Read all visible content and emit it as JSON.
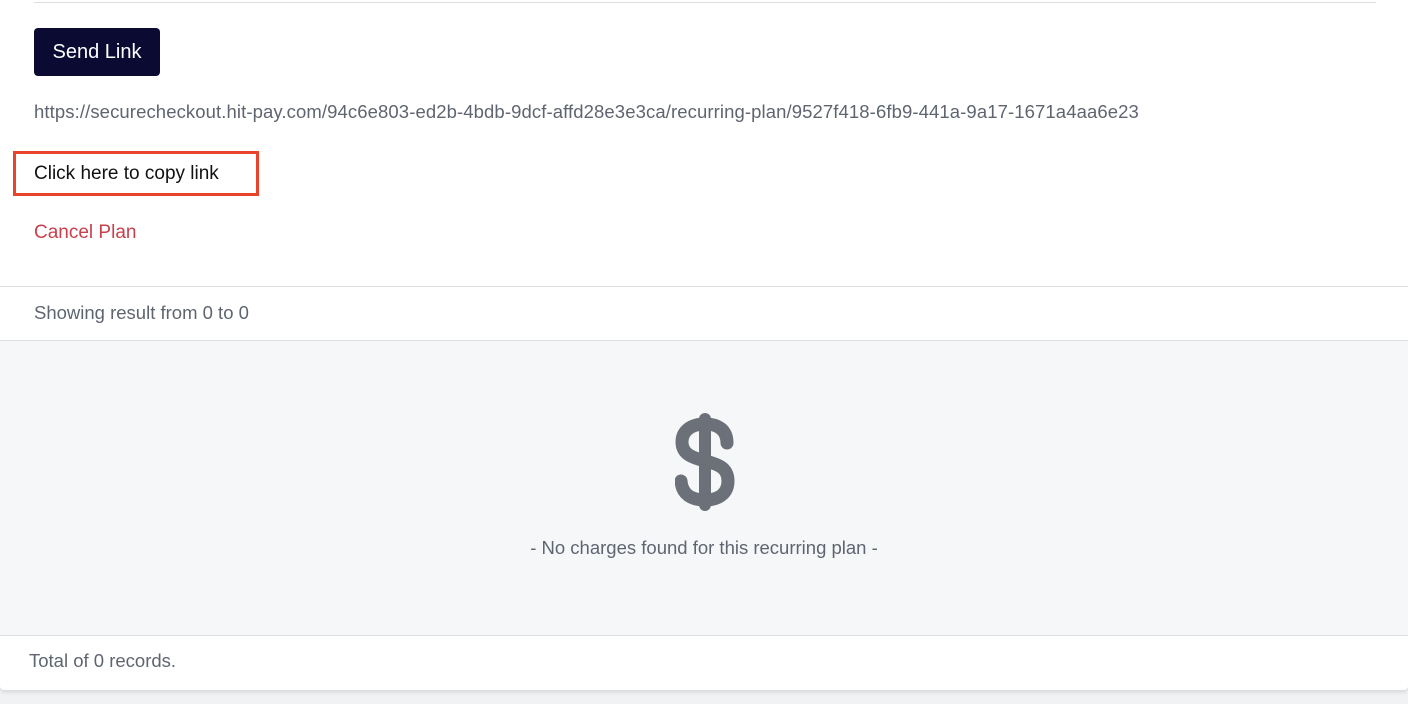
{
  "actions": {
    "send_link_label": "Send Link",
    "checkout_url": "https://securecheckout.hit-pay.com/94c6e803-ed2b-4bdb-9dcf-affd28e3e3ca/recurring-plan/9527f418-6fb9-441a-9a17-1671a4aa6e23",
    "copy_link_label": "Click here to copy link",
    "cancel_plan_label": "Cancel Plan"
  },
  "charges": {
    "showing_text": "Showing result from 0 to 0",
    "empty_icon": "dollar-icon",
    "empty_message": "- No charges found for this recurring plan -",
    "total_text": "Total of 0 records."
  },
  "colors": {
    "primary_button": "#0b0a33",
    "danger_text": "#c9404c",
    "highlight_border": "#e8442b",
    "muted_text": "#5f6570",
    "icon": "#6b7079"
  }
}
